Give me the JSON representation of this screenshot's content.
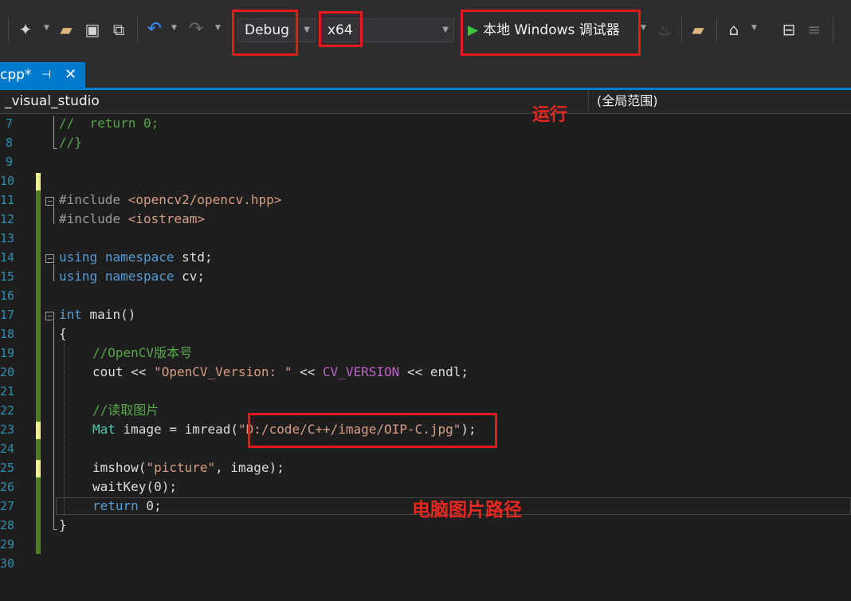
{
  "toolbar": {
    "configuration": "Debug",
    "platform": "x64",
    "run_label": "本地 Windows 调试器",
    "icons": [
      "new-item-icon",
      "open-folder-icon",
      "save-icon",
      "save-all-icon",
      "undo-icon",
      "redo-icon",
      "play-icon",
      "hot-reload-icon",
      "folder-icon",
      "home-icon",
      "bookmark-icon",
      "align-icon"
    ]
  },
  "tab": {
    "label": "cpp*",
    "pin": "⊣",
    "close": "✕"
  },
  "nav": {
    "file": "_visual_studio",
    "scope": "(全局范围)"
  },
  "annotations": {
    "run": "运行",
    "path": "电脑图片路径"
  },
  "editor": {
    "line_numbers": [
      "7",
      "8",
      "9",
      "10",
      "11",
      "12",
      "13",
      "14",
      "15",
      "16",
      "17",
      "18",
      "19",
      "20",
      "21",
      "22",
      "23",
      "24",
      "25",
      "26",
      "27",
      "28",
      "29",
      "30"
    ],
    "lines": {
      "l7_comment": "//  return 0;",
      "l8_comment": "//}",
      "l11_directive": "#include ",
      "l11_header": "<opencv2/opencv.hpp>",
      "l12_directive": "#include ",
      "l12_header": "<iostream>",
      "l14_kw1": "using",
      "l14_kw2": "namespace",
      "l14_name": "std;",
      "l15_kw1": "using",
      "l15_kw2": "namespace",
      "l15_name": "cv;",
      "l17_kw": "int",
      "l17_rest": " main()",
      "l18": "{",
      "l19_comment": "//OpenCV版本号",
      "l20_a": "cout << ",
      "l20_str": "\"OpenCV_Version: \"",
      "l20_b": " << ",
      "l20_macro": "CV_VERSION",
      "l20_c": " << endl;",
      "l22_comment": "//读取图片",
      "l23_type": "Mat",
      "l23_a": " image = imread(",
      "l23_str": "\"D:/code/C++/image/OIP-C.jpg\"",
      "l23_b": ");",
      "l25_a": "imshow(",
      "l25_str": "\"picture\"",
      "l25_b": ", image);",
      "l26": "waitKey(0);",
      "l27_kw": "return",
      "l27_rest": " 0;",
      "l28": "}"
    }
  },
  "colors": {
    "accent": "#007acc",
    "annotation": "#e01b1b",
    "play": "#3ac43a"
  }
}
